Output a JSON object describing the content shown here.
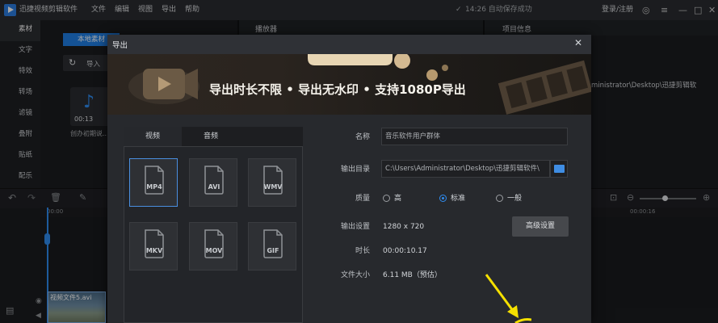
{
  "titlebar": {
    "app_name": "迅捷视频剪辑软件",
    "menus": [
      "文件",
      "编辑",
      "视图",
      "导出",
      "帮助"
    ],
    "autosave": "14:26 自动保存成功",
    "login": "登录/注册"
  },
  "leftnav": {
    "items": [
      "素材",
      "文字",
      "特效",
      "转场",
      "滤镜",
      "叠附",
      "贴纸",
      "配乐"
    ]
  },
  "materials": {
    "local_tab": "本地素材",
    "import_label": "导入",
    "thumb_duration": "00:13",
    "thumb_name": "创办初期说..."
  },
  "player": {
    "header": "播放器"
  },
  "info": {
    "header": "项目信息",
    "path_fragment": "ministrator\\Desktop\\迅捷剪辑软"
  },
  "timeline": {
    "ruler_start": "00:00",
    "ruler_end": "00:00:16",
    "clip_label": "视频文件5.avi"
  },
  "export_dialog": {
    "title": "导出",
    "banner_text": "导出时长不限 • 导出无水印 • 支持1080P导出",
    "tabs": [
      "视频",
      "音频"
    ],
    "formats": [
      "MP4",
      "AVI",
      "WMV",
      "MKV",
      "MOV",
      "GIF"
    ],
    "selected_format": "MP4",
    "fields": {
      "name_label": "名称",
      "name_value": "音乐软件用户群体",
      "dir_label": "输出目录",
      "dir_value": "C:\\Users\\Administrator\\Desktop\\迅捷剪辑软件\\",
      "quality_label": "质量",
      "quality_options": [
        "高",
        "标准",
        "一般"
      ],
      "quality_selected": "标准",
      "output_label": "输出设置",
      "output_value": "1280 x 720",
      "advanced_button": "高级设置",
      "duration_label": "时长",
      "duration_value": "00:00:10.17",
      "size_label": "文件大小",
      "size_value": "6.11 MB（预估）"
    }
  },
  "colors": {
    "accent": "#2f8cf0",
    "arrow": "#f5e000"
  }
}
